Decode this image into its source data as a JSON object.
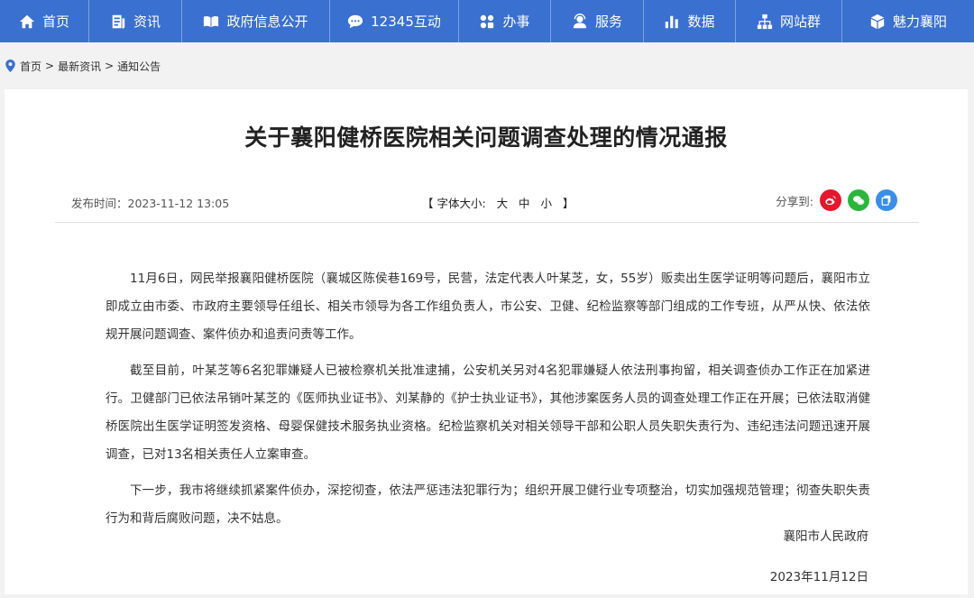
{
  "nav": {
    "items": [
      {
        "label": "首页",
        "icon": "home-icon"
      },
      {
        "label": "资讯",
        "icon": "news-icon"
      },
      {
        "label": "政府信息公开",
        "icon": "open-book-icon"
      },
      {
        "label": "12345互动",
        "icon": "chat-bubble-icon"
      },
      {
        "label": "办事",
        "icon": "grid-icon"
      },
      {
        "label": "服务",
        "icon": "user-service-icon"
      },
      {
        "label": "数据",
        "icon": "bar-chart-icon"
      },
      {
        "label": "网站群",
        "icon": "sitemap-icon"
      },
      {
        "label": "魅力襄阳",
        "icon": "cube-icon"
      }
    ]
  },
  "breadcrumb": {
    "home": "首页",
    "sep": ">",
    "level1": "最新资讯",
    "level2": "通知公告"
  },
  "article": {
    "title": "关于襄阳健桥医院相关问题调查处理的情况通报",
    "publish": "发布时间：2023-11-12 13:05",
    "font_label": "【 字体大小:",
    "font_large": "大",
    "font_medium": "中",
    "font_small": "小",
    "font_end": "】",
    "share_label": "分享到:",
    "paragraphs": [
      "11月6日，网民举报襄阳健桥医院（襄城区陈侯巷169号，民营，法定代表人叶某芝，女，55岁）贩卖出生医学证明等问题后，襄阳市立即成立由市委、市政府主要领导任组长、相关市领导为各工作组负责人，市公安、卫健、纪检监察等部门组成的工作专班，从严从快、依法依规开展问题调查、案件侦办和追责问责等工作。",
      "截至目前，叶某芝等6名犯罪嫌疑人已被检察机关批准逮捕，公安机关另对4名犯罪嫌疑人依法刑事拘留，相关调查侦办工作正在加紧进行。卫健部门已依法吊销叶某芝的《医师执业证书》、刘某静的《护士执业证书》，其他涉案医务人员的调查处理工作正在开展；已依法取消健桥医院出生医学证明签发资格、母婴保健技术服务执业资格。纪检监察机关对相关领导干部和公职人员失职失责行为、违纪违法问题迅速开展调查，已对13名相关责任人立案审查。",
      "下一步，我市将继续抓紧案件侦办，深挖彻查，依法严惩违法犯罪行为；组织开展卫健行业专项整治，切实加强规范管理；彻查失职失责行为和背后腐败问题，决不姑息。"
    ],
    "signature": "襄阳市人民政府",
    "date": "2023年11月12日"
  },
  "colors": {
    "nav_bg": "#3a70cf",
    "weibo": "#e6162d",
    "wechat": "#2bb53c",
    "copy": "#3a8ee6"
  }
}
